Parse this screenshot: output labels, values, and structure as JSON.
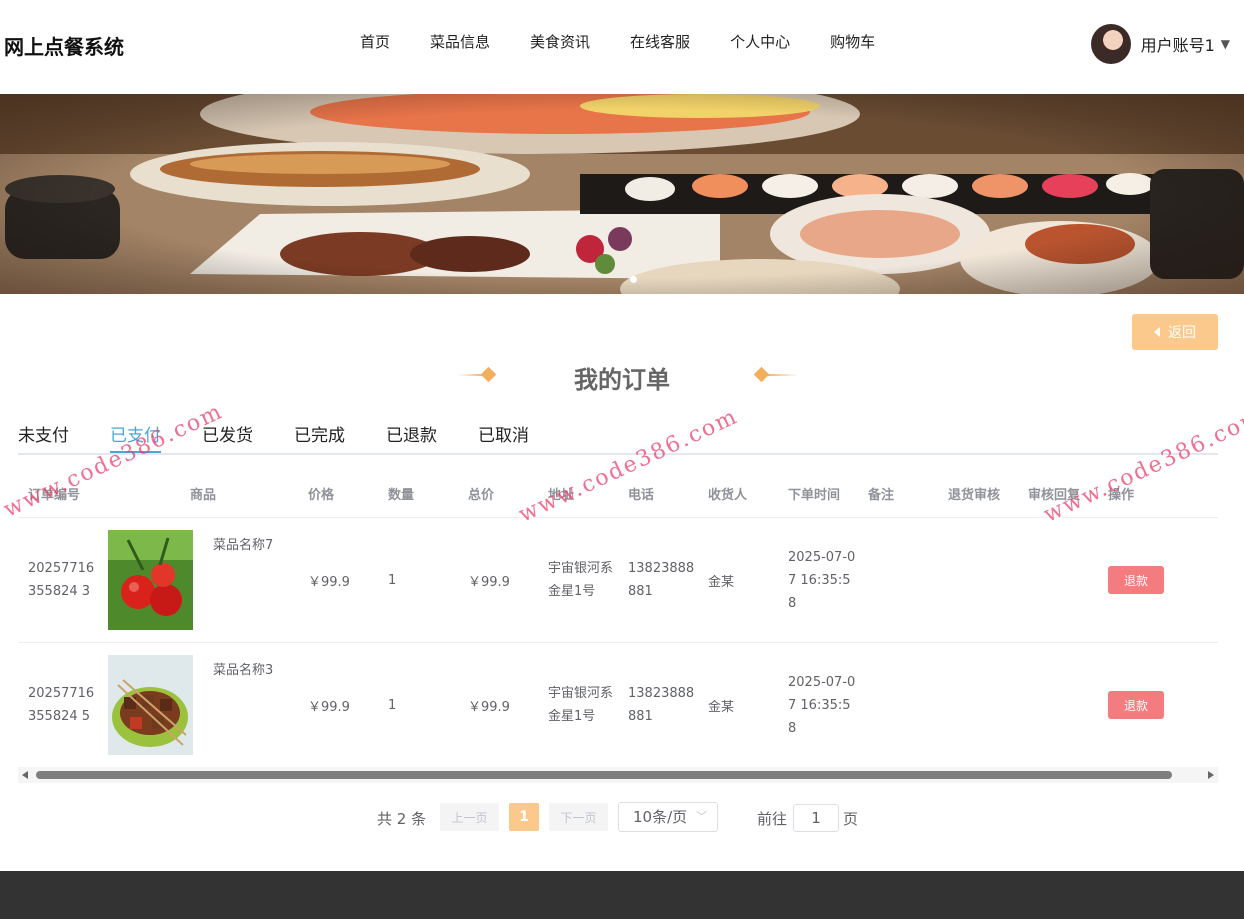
{
  "header": {
    "logo": "网上点餐系统",
    "nav": [
      "首页",
      "菜品信息",
      "美食资讯",
      "在线客服",
      "个人中心",
      "购物车"
    ],
    "user_name": "用户账号1"
  },
  "back_label": "返回",
  "page_title": "我的订单",
  "tabs": [
    "未支付",
    "已支付",
    "已发货",
    "已完成",
    "已退款",
    "已取消"
  ],
  "active_tab": "已支付",
  "table": {
    "columns": [
      "订单编号",
      "商品",
      "价格",
      "数量",
      "总价",
      "地址",
      "电话",
      "收货人",
      "下单时间",
      "备注",
      "退货审核",
      "审核回复",
      "操作"
    ],
    "rows": [
      {
        "order_no": "20257716355824 3",
        "goods_name": "菜品名称7",
        "goods_image": "tomato",
        "price": "￥99.9",
        "qty": "1",
        "total": "￥99.9",
        "address": "宇宙银河系金星1号",
        "phone": "13823888881",
        "receiver": "金某",
        "time": "2025-07-07 16:35:58",
        "note": "",
        "return_review": "",
        "review_reply": "",
        "action": "退款"
      },
      {
        "order_no": "20257716355824 5",
        "goods_name": "菜品名称3",
        "goods_image": "skewers",
        "price": "￥99.9",
        "qty": "1",
        "total": "￥99.9",
        "address": "宇宙银河系金星1号",
        "phone": "13823888881",
        "receiver": "金某",
        "time": "2025-07-07 16:35:58",
        "note": "",
        "return_review": "",
        "review_reply": "",
        "action": "退款"
      }
    ]
  },
  "pagination": {
    "total_text": "共 2 条",
    "prev": "上一页",
    "current": "1",
    "next": "下一页",
    "page_size": "10条/页",
    "goto_prefix": "前往",
    "goto_value": "1",
    "goto_suffix": "页"
  },
  "watermark": "www.code386.com",
  "colors": {
    "accent": "#fbc98c",
    "active_tab": "#4aa6d9",
    "refund_button": "#f47b7e",
    "footer": "#333333"
  }
}
